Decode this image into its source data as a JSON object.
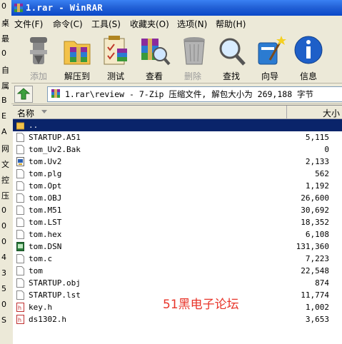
{
  "window": {
    "title": "1.rar - WinRAR"
  },
  "menu": [
    "文件(F)",
    "命令(C)",
    "工具(S)",
    "收藏夹(O)",
    "选项(N)",
    "帮助(H)"
  ],
  "toolbar": [
    {
      "label": "添加",
      "icon": "add-icon",
      "enabled": false
    },
    {
      "label": "解压到",
      "icon": "extract-to-icon",
      "enabled": true
    },
    {
      "label": "测试",
      "icon": "test-icon",
      "enabled": true
    },
    {
      "label": "查看",
      "icon": "view-icon",
      "enabled": true
    },
    {
      "label": "删除",
      "icon": "delete-icon",
      "enabled": false
    },
    {
      "label": "查找",
      "icon": "find-icon",
      "enabled": true
    },
    {
      "label": "向导",
      "icon": "wizard-icon",
      "enabled": true
    },
    {
      "label": "信息",
      "icon": "info-icon",
      "enabled": true
    }
  ],
  "address": {
    "path": "1.rar\\review - 7-Zip 压缩文件, 解包大小为 269,188 字节"
  },
  "list": {
    "columns": {
      "name": "名称",
      "size": "大小"
    },
    "rows": [
      {
        "name": "..",
        "size": "",
        "type": "parent",
        "selected": true
      },
      {
        "name": "STARTUP.A51",
        "size": "5,115",
        "type": "file"
      },
      {
        "name": "tom_Uv2.Bak",
        "size": "0",
        "type": "file"
      },
      {
        "name": "tom.Uv2",
        "size": "2,133",
        "type": "uv2"
      },
      {
        "name": "tom.plg",
        "size": "562",
        "type": "file"
      },
      {
        "name": "tom.Opt",
        "size": "1,192",
        "type": "file"
      },
      {
        "name": "tom.OBJ",
        "size": "26,600",
        "type": "file"
      },
      {
        "name": "tom.M51",
        "size": "30,692",
        "type": "file"
      },
      {
        "name": "tom.LST",
        "size": "18,352",
        "type": "file"
      },
      {
        "name": "tom.hex",
        "size": "6,108",
        "type": "file"
      },
      {
        "name": "tom.DSN",
        "size": "131,360",
        "type": "dsn"
      },
      {
        "name": "tom.c",
        "size": "7,223",
        "type": "file"
      },
      {
        "name": "tom",
        "size": "22,548",
        "type": "file"
      },
      {
        "name": "STARTUP.obj",
        "size": "874",
        "type": "file"
      },
      {
        "name": "STARTUP.lst",
        "size": "11,774",
        "type": "file"
      },
      {
        "name": "key.h",
        "size": "1,002",
        "type": "header"
      },
      {
        "name": "ds1302.h",
        "size": "3,653",
        "type": "header"
      }
    ]
  },
  "watermark": "51黑电子论坛",
  "desktop_edge": [
    "0",
    "桌",
    "最",
    "0",
    "自",
    "属",
    "B",
    "E",
    "A",
    "网",
    "文",
    "控",
    "压",
    "0",
    "0",
    "0",
    "4",
    "3",
    "5",
    "0",
    "S"
  ],
  "colors": {
    "selection": "#0a246a",
    "title_bar": "#2462d7",
    "watermark": "#e8352a"
  }
}
